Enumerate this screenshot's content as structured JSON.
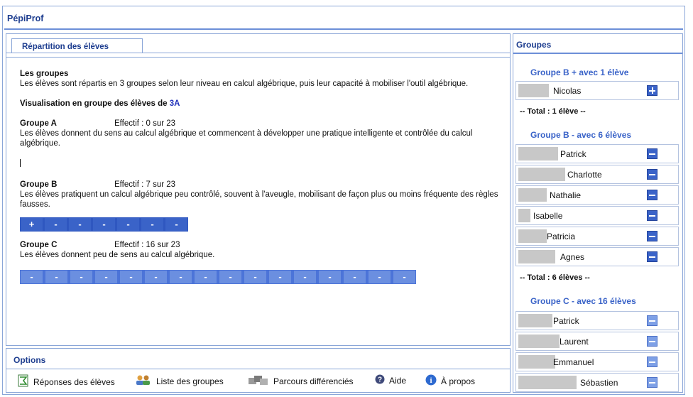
{
  "app": {
    "title": "PépiProf"
  },
  "main": {
    "tab": "Répartition des élèves",
    "groups_heading": "Les groupes",
    "groups_desc": "Les élèves sont répartis en 3 groupes selon leur niveau en calcul algébrique, puis leur capacité à mobiliser l'outil algébrique.",
    "visu_prefix": "Visualisation en groupe des élèves de ",
    "visu_class": "3A",
    "groupA": {
      "name": "Groupe A",
      "effectif": "Effectif : 0 sur 23",
      "desc": "Les élèves donnent du sens au calcul algébrique et commencent à développer une pratique intelligente et contrôlée du calcul algébrique."
    },
    "groupB": {
      "name": "Groupe B",
      "effectif": "Effectif : 7 sur 23",
      "desc": "Les élèves pratiquent un calcul algébrique peu contrôlé, souvent à l'aveugle, mobilisant de façon plus ou moins fréquente des règles fausses.",
      "buttons": [
        "+",
        "-",
        "-",
        "-",
        "-",
        "-",
        "-"
      ]
    },
    "groupC": {
      "name": "Groupe C",
      "effectif": "Effectif : 16 sur 23",
      "desc": "Les élèves donnent peu de sens au calcul algébrique.",
      "buttons": [
        "-",
        "-",
        "-",
        "-",
        "-",
        "-",
        "-",
        "-",
        "-",
        "-",
        "-",
        "-",
        "-",
        "-",
        "-",
        "-"
      ]
    }
  },
  "options": {
    "title": "Options",
    "items": [
      {
        "label": "Réponses des élèves",
        "icon": "csv-icon"
      },
      {
        "label": "Liste des groupes",
        "icon": "users-icon"
      },
      {
        "label": "Parcours différenciés",
        "icon": "path-icon"
      },
      {
        "label": "Aide",
        "icon": "help-icon"
      },
      {
        "label": "À propos",
        "icon": "info-icon"
      }
    ]
  },
  "side": {
    "title": "Groupes",
    "groups": [
      {
        "title": "Groupe B + avec 1  élève",
        "total": "-- Total :  1 élève --",
        "students": [
          {
            "name": "Nicolas",
            "action": "+"
          }
        ]
      },
      {
        "title": "Groupe B - avec 6  élèves",
        "total": "-- Total :  6 élèves --",
        "students": [
          {
            "name": "Patrick",
            "action": "-"
          },
          {
            "name": "Charlotte",
            "action": "-"
          },
          {
            "name": "Nathalie",
            "action": "-"
          },
          {
            "name": "Isabelle",
            "action": "-"
          },
          {
            "name": "Patricia",
            "action": "-"
          },
          {
            "name": "Agnes",
            "action": "-"
          }
        ]
      },
      {
        "title": "Groupe C - avec 16  élèves",
        "students": [
          {
            "name": "Patrick",
            "action": "-"
          },
          {
            "name": "Laurent",
            "action": "-"
          },
          {
            "name": "Emmanuel",
            "action": "-"
          },
          {
            "name": "Sébastien",
            "action": "-"
          }
        ]
      }
    ]
  }
}
